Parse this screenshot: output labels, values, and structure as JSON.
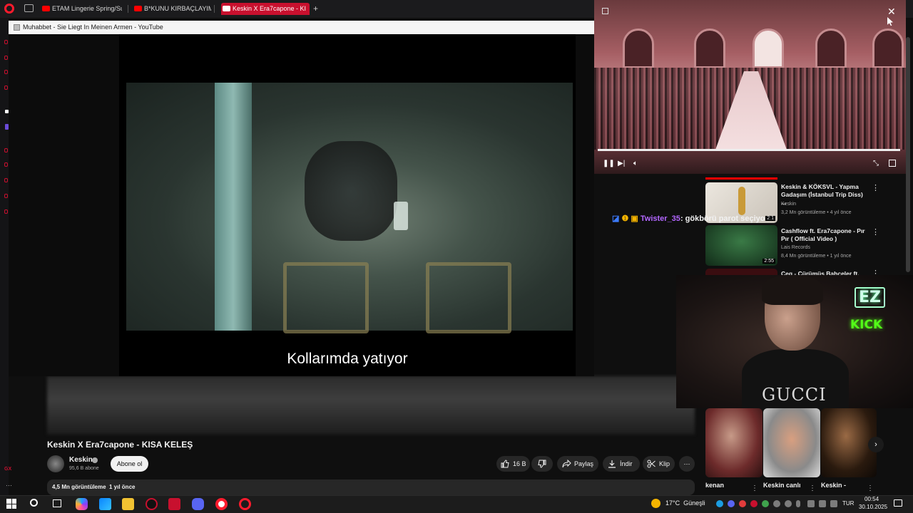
{
  "browser": {
    "tabs": [
      {
        "label": "ETAM Lingerie Spring/Su"
      },
      {
        "label": "B*KUNU KIRBAÇLAYIM"
      },
      {
        "label": "Keskin X Era7capone - KI"
      }
    ],
    "new_tab": "+"
  },
  "popup": {
    "window_title": "Muhabbet - Sie Liegt In Meinen Armen - YouTube",
    "subtitle": "Kollarımda yatıyor"
  },
  "video": {
    "title": "Keskin X Era7capone - KISA KELEŞ",
    "channel": "Keskin",
    "subscribers": "95,6 B abone",
    "subscribe_label": "Abone ol",
    "likes": "16 B",
    "share_label": "Paylaş",
    "download_label": "İndir",
    "clip_label": "Klip",
    "more_label": "⋯",
    "views": "4,5 Mn görüntüleme",
    "date": "1 yıl önce"
  },
  "pip": {
    "close": "✕"
  },
  "recommendations": [
    {
      "title": "Keskin & KÖKSVL - Yapma Gadaşım (İstanbul Trip Diss) ...",
      "channel": "Keskin",
      "meta": "3,2 Mn görüntüleme • 4 yıl önce",
      "duration": "2:1"
    },
    {
      "title": "Cashflow ft. Era7capone - Pır Pır ( Official Video )",
      "channel": "Lais Records",
      "meta": "8,4 Mn görüntüleme • 1 yıl önce",
      "duration": "2:55"
    },
    {
      "title": "Ceg - Çürümüş Bahçeler ft.",
      "channel": "",
      "meta": "",
      "duration": ""
    }
  ],
  "chat": {
    "user": "Twister_35",
    "message": ": gökbörü parot seçiyo"
  },
  "stream": {
    "sign_ez": "EZ",
    "sign_kick": "KICK",
    "shirt_text": "GUCCI"
  },
  "shorts": [
    {
      "title": "kenan"
    },
    {
      "title": "Keskin canlı"
    },
    {
      "title": "Keskin -"
    }
  ],
  "taskbar": {
    "weather_temp": "17°C",
    "weather_desc": "Güneşli",
    "lang": "TUR",
    "time": "00:54",
    "date": "30.10.2025"
  },
  "colors": {
    "opera_red": "#ff1b2d",
    "active_tab": "#c8102e",
    "youtube_red": "#ff0000",
    "kick_green": "#53fc18",
    "chat_user": "#b266ff"
  }
}
